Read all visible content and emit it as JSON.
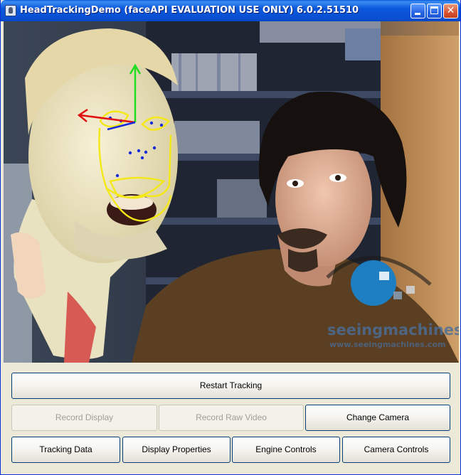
{
  "window": {
    "title": "HeadTrackingDemo (faceAPI EVALUATION USE ONLY)  6.0.2.51510",
    "min_glyph": "",
    "max_glyph": "",
    "close_glyph": "✕"
  },
  "video": {
    "watermark_brand": "seeingmachines",
    "watermark_url": "www.seeingmachines.com"
  },
  "controls": {
    "restart_tracking": "Restart Tracking",
    "record_display": "Record Display",
    "record_raw_video": "Record Raw Video",
    "change_camera": "Change Camera",
    "tracking_data": "Tracking Data",
    "display_properties": "Display Properties",
    "engine_controls": "Engine Controls",
    "camera_controls": "Camera Controls"
  },
  "states": {
    "record_display_enabled": false,
    "record_raw_video_enabled": false
  },
  "colors": {
    "titlebar": "#0a4ed1",
    "axis_x": "#e01010",
    "axis_y": "#22dd22",
    "axis_z": "#1a2bd8",
    "face_mesh": "#f4e81a",
    "watermark_blue": "#1d7fc2"
  }
}
